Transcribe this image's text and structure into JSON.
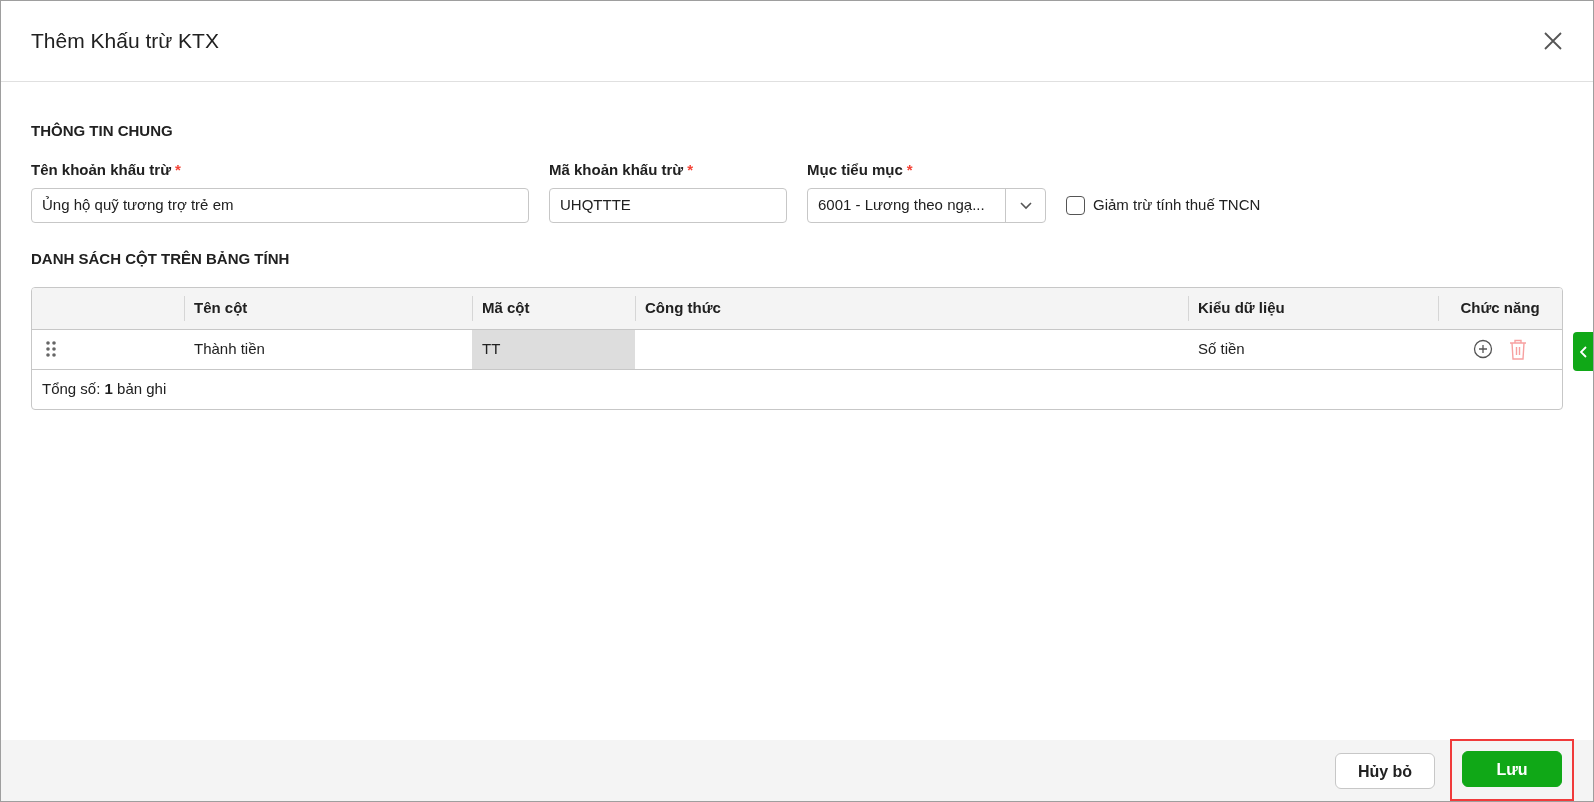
{
  "dialog": {
    "title": "Thêm Khấu trừ KTX"
  },
  "general_section": {
    "title": "THÔNG TIN CHUNG",
    "fields": [
      {
        "kind": "text",
        "label": "Tên khoản khấu trừ",
        "required_mark": "*",
        "value": "Ủng hộ quỹ tương trợ trẻ em"
      },
      {
        "kind": "text",
        "label": "Mã khoản khấu trừ",
        "required_mark": "*",
        "value": "UHQTTTE"
      },
      {
        "kind": "select",
        "label": "Mục tiểu mục",
        "required_mark": "*",
        "value": "6001 - Lương theo ngạ..."
      }
    ],
    "checkbox": {
      "label": "Giảm trừ tính thuế TNCN",
      "checked": false
    }
  },
  "columns_section": {
    "title": "DANH SÁCH CỘT TRÊN BẢNG TÍNH",
    "table": {
      "columns": [
        "",
        "Tên cột",
        "Mã cột",
        "Công thức",
        "Kiểu dữ liệu",
        "Chức năng"
      ],
      "rows": [
        {
          "name": "Thành tiền",
          "code": "TT",
          "code_locked": true,
          "formula": "",
          "type": "Số tiền"
        }
      ],
      "footer": "Tổng số: **1** bản ghi"
    }
  },
  "footer": {
    "buttons": [
      {
        "kind": "secondary",
        "label": "Hủy bỏ",
        "highlighted": false
      },
      {
        "kind": "primary",
        "label": "Lưu",
        "highlighted": true
      }
    ]
  }
}
